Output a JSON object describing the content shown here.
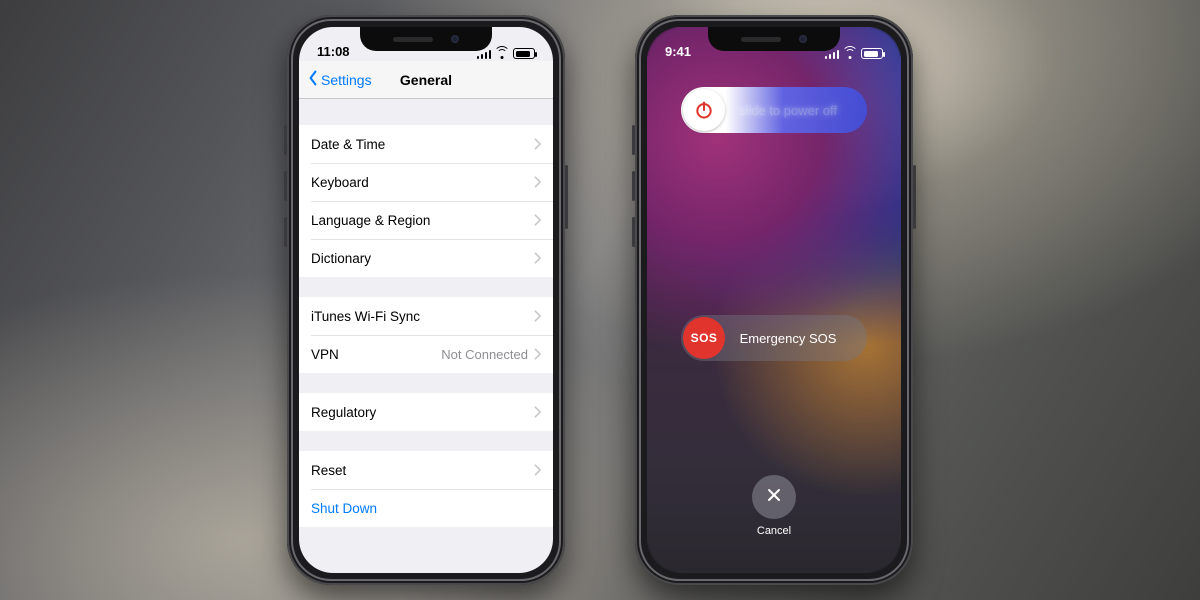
{
  "left": {
    "status_time": "11:08",
    "nav_back": "Settings",
    "nav_title": "General",
    "rows": {
      "date_time": "Date & Time",
      "keyboard": "Keyboard",
      "language_region": "Language & Region",
      "dictionary": "Dictionary",
      "itunes_wifi": "iTunes Wi-Fi Sync",
      "vpn": "VPN",
      "vpn_detail": "Not Connected",
      "regulatory": "Regulatory",
      "reset": "Reset",
      "shut_down": "Shut Down"
    }
  },
  "right": {
    "status_time": "9:41",
    "power_label": "slide to power off",
    "sos_knob": "SOS",
    "sos_label": "Emergency SOS",
    "cancel": "Cancel"
  }
}
